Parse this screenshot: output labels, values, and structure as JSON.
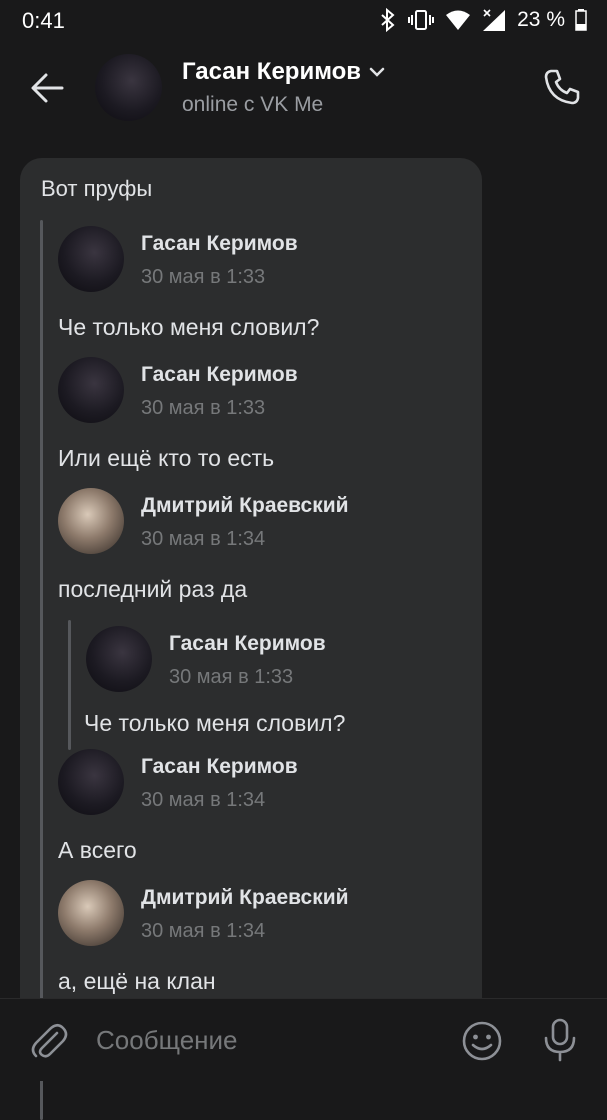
{
  "statusbar": {
    "time": "0:41",
    "battery": "23 %"
  },
  "header": {
    "name": "Гасан Керимов",
    "status": "online с VK Me"
  },
  "message": {
    "text": "Вот пруфы",
    "forwarded": [
      {
        "author": "Гасан Керимов",
        "date": "30 мая в 1:33",
        "text": "Че только меня словил?",
        "avatar": "dark"
      },
      {
        "author": "Гасан Керимов",
        "date": "30 мая в 1:33",
        "text": "Или ещё кто то есть",
        "avatar": "dark"
      },
      {
        "author": "Дмитрий Краевский",
        "date": "30 мая в 1:34",
        "text": "последний раз да",
        "avatar": "light"
      },
      {
        "author": "Гасан Керимов",
        "date": "30 мая в 1:34",
        "text": "А всего",
        "avatar": "dark"
      },
      {
        "author": "Дмитрий Краевский",
        "date": "30 мая в 1:34",
        "text": "а, ещё на клан",
        "avatar": "light"
      }
    ],
    "nested": {
      "author": "Гасан Керимов",
      "date": "30 мая в 1:33",
      "text": "Че только меня словил?"
    }
  },
  "composer": {
    "placeholder": "Сообщение"
  }
}
